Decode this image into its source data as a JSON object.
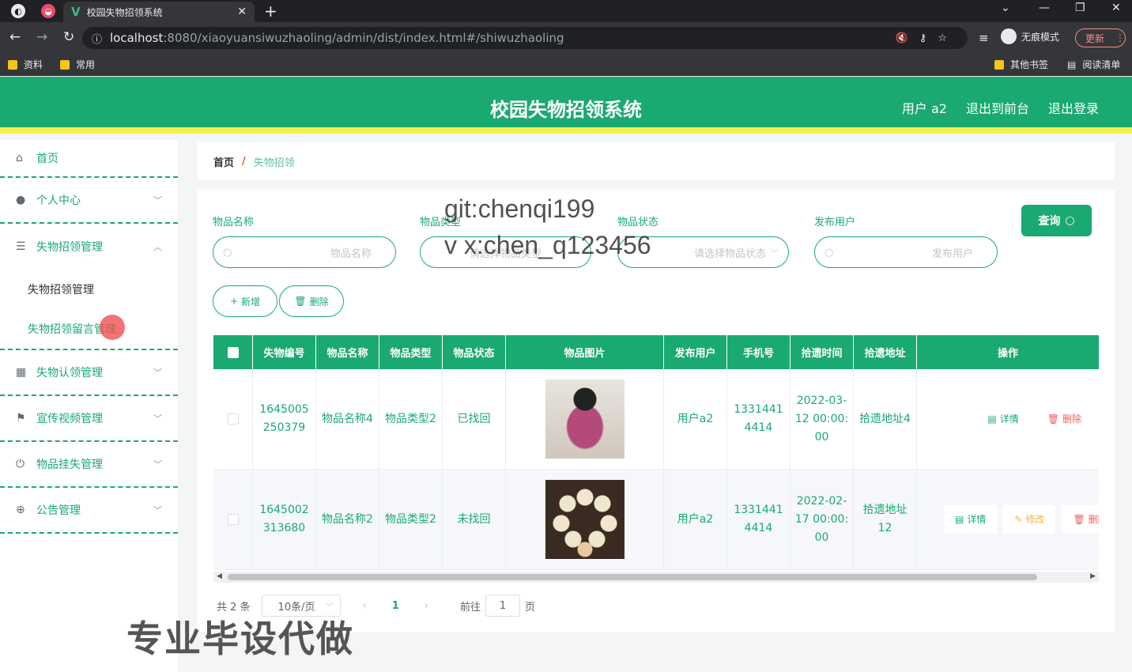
{
  "browser": {
    "tab_title": "校园失物招领系统",
    "url_host": "localhost",
    "url_rest": ":8080/xiaoyuansiwuzhaoling/admin/dist/index.html#/shiwuzhaoling",
    "incognito_label": "无痕模式",
    "update_label": "更新",
    "bookmarks": [
      "资料",
      "常用"
    ],
    "bookmarks_right": [
      "其他书签",
      "阅读清单"
    ]
  },
  "header": {
    "title": "校园失物招领系统",
    "user": "用户 a2",
    "to_front": "退出到前台",
    "logout": "退出登录"
  },
  "sidebar": {
    "items": [
      {
        "label": "首页"
      },
      {
        "label": "个人中心"
      },
      {
        "label": "失物招领管理"
      },
      {
        "label": "失物认领管理"
      },
      {
        "label": "宣传视频管理"
      },
      {
        "label": "物品挂失管理"
      },
      {
        "label": "公告管理"
      }
    ],
    "sub_items": [
      "失物招领管理",
      "失物招领留言管理"
    ]
  },
  "breadcrumb": {
    "home": "首页",
    "current": "失物招领"
  },
  "filters": {
    "name_label": "物品名称",
    "name_placeholder": "物品名称",
    "type_label": "物品类型",
    "type_placeholder": "请选择物品类型",
    "status_label": "物品状态",
    "status_placeholder": "请选择物品状态",
    "user_label": "发布用户",
    "user_placeholder": "发布用户",
    "query": "查询"
  },
  "actions": {
    "add": "新增",
    "delete": "删除"
  },
  "watermark": {
    "line1": "git:chenqi199",
    "line2": "v x:chen_q123456",
    "banner": "专业毕设代做"
  },
  "table": {
    "columns": [
      "失物编号",
      "物品名称",
      "物品类型",
      "物品状态",
      "物品图片",
      "发布用户",
      "手机号",
      "拾遗时间",
      "拾遗地址",
      "操作"
    ],
    "rows": [
      {
        "id": "1645005250379",
        "name": "物品名称4",
        "type": "物品类型2",
        "status": "已找回",
        "user": "用户a2",
        "phone": "13314414414",
        "time": "2022-03-12 00:00:00",
        "addr": "拾遗地址4"
      },
      {
        "id": "1645002313680",
        "name": "物品名称2",
        "type": "物品类型2",
        "status": "未找回",
        "user": "用户a2",
        "phone": "13314414414",
        "time": "2022-02-17 00:00:00",
        "addr": "拾遗地址12"
      }
    ],
    "op_detail": "详情",
    "op_edit": "修改",
    "op_delete": "删除"
  },
  "pagination": {
    "total": "共 2 条",
    "page_size": "10条/页",
    "current": "1",
    "goto": "前往",
    "goto_value": "1",
    "page_unit": "页"
  }
}
